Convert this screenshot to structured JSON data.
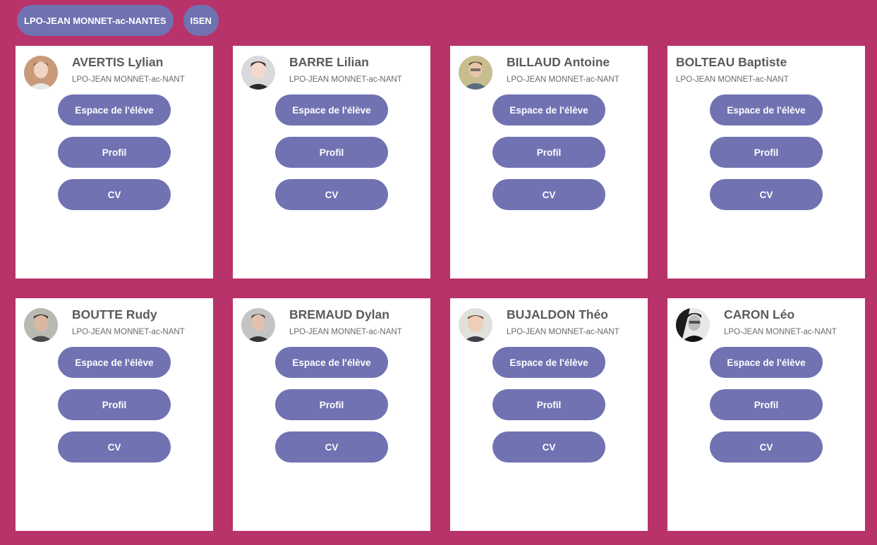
{
  "filters": [
    {
      "label": "LPO-JEAN MONNET-ac-NANTES"
    },
    {
      "label": "ISEN"
    }
  ],
  "buttons": {
    "space": "Espace de l'élève",
    "profile": "Profil",
    "cv": "CV"
  },
  "students": [
    {
      "name": "AVERTIS Lylian",
      "school": "LPO-JEAN MONNET-ac-NANTES",
      "has_photo": true
    },
    {
      "name": "BARRE Lilian",
      "school": "LPO-JEAN MONNET-ac-NANTES",
      "has_photo": true
    },
    {
      "name": "BILLAUD Antoine",
      "school": "LPO-JEAN MONNET-ac-NANTES",
      "has_photo": true
    },
    {
      "name": "BOLTEAU Baptiste",
      "school": "LPO-JEAN MONNET-ac-NANTES",
      "has_photo": false
    },
    {
      "name": "BOUTTE Rudy",
      "school": "LPO-JEAN MONNET-ac-NANTES",
      "has_photo": true
    },
    {
      "name": "BREMAUD Dylan",
      "school": "LPO-JEAN MONNET-ac-NANTES",
      "has_photo": true
    },
    {
      "name": "BUJALDON Théo",
      "school": "LPO-JEAN MONNET-ac-NANTES",
      "has_photo": true
    },
    {
      "name": "CARON Léo",
      "school": "LPO-JEAN MONNET-ac-NANTES",
      "has_photo": true
    }
  ],
  "colors": {
    "background": "#b8336a",
    "accent": "#7072b2",
    "card": "#ffffff"
  }
}
